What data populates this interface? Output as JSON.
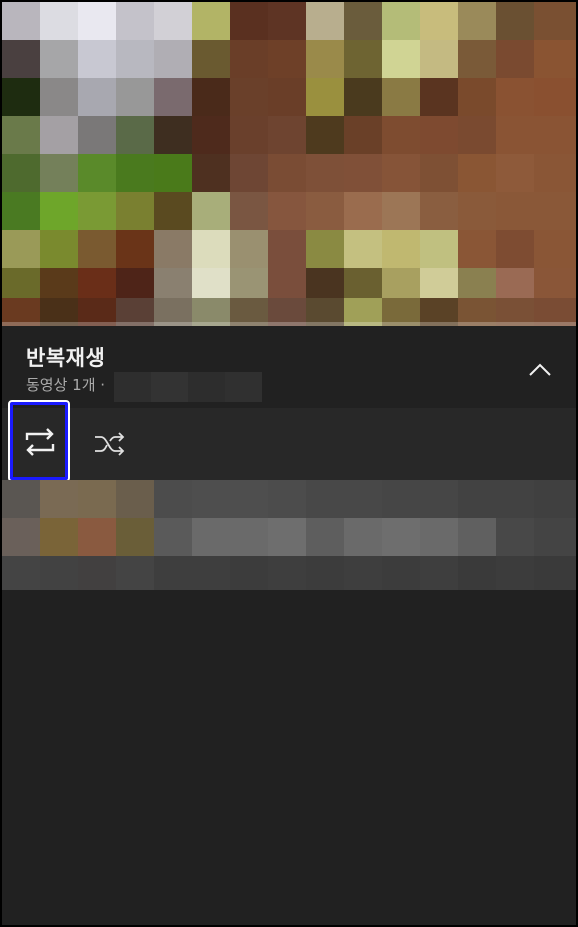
{
  "playlist": {
    "title": "반복재생",
    "subtitle": "동영상 1개 ·"
  },
  "icons": {
    "collapse": "chevron-up-icon",
    "loop": "repeat-icon",
    "shuffle": "shuffle-icon"
  },
  "colors": {
    "panel_bg": "#212121",
    "controls_bg": "#282828",
    "text_primary": "#f1f1f1",
    "text_secondary": "#aaaaaa",
    "highlight_border": "#1a1aff",
    "progress": "#e53935"
  },
  "player": {
    "progress": 0.0
  }
}
